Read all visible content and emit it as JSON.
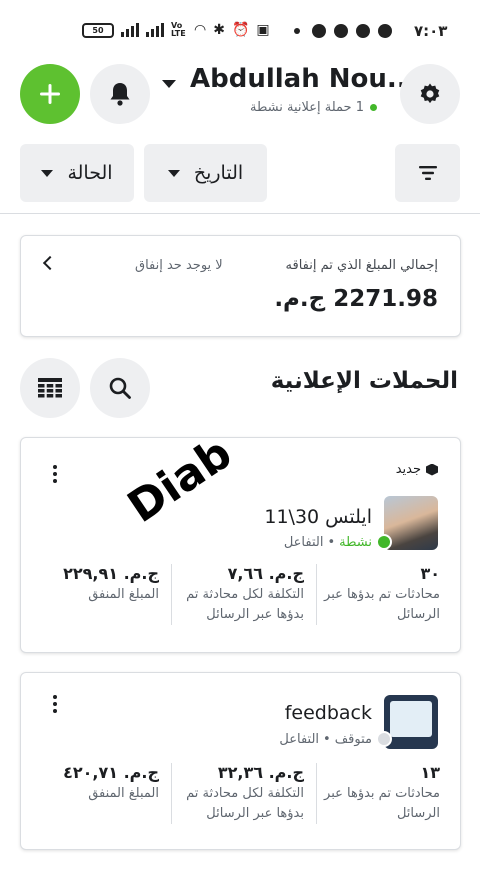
{
  "status_bar": {
    "time": "٧:٠٣",
    "battery": "50",
    "network_label": "Vo LTE"
  },
  "header": {
    "account_name": "Abdullah Nou...",
    "active_campaigns": "1 حملة إعلانية نشطة"
  },
  "filters": {
    "status_label": "الحالة",
    "date_label": "التاريخ"
  },
  "spend": {
    "label": "إجمالي المبلغ الذي تم إنفاقه",
    "limit_text": "لا يوجد حد إنفاق",
    "amount": "2271.98 ج.م."
  },
  "section_title": "الحملات الإعلانية",
  "campaigns": [
    {
      "badge": "جديد",
      "name": "ايلتس 30\\11",
      "status": "نشطة",
      "objective": "التفاعل",
      "status_color": "#42b72a",
      "conversations_value": "٣٠",
      "conversations_label": "محادثات تم بدؤها عبر الرسائل",
      "cost_value": "ج.م. ٧,٦٦",
      "cost_label": "التكلفة لكل محادثة تم بدؤها عبر الرسائل",
      "spent_value": "ج.م. ٢٢٩,٩١",
      "spent_label": "المبلغ المنفق"
    },
    {
      "name": "feedback",
      "status": "متوقف",
      "objective": "التفاعل",
      "status_color": "#dadde1",
      "conversations_value": "١٣",
      "conversations_label": "محادثات تم بدؤها عبر الرسائل",
      "cost_value": "ج.م. ٣٢,٣٦",
      "cost_label": "التكلفة لكل محادثة تم بدؤها عبر الرسائل",
      "spent_value": "ج.م. ٤٢٠,٧١",
      "spent_label": "المبلغ المنفق"
    }
  ],
  "watermark": "Diab",
  "colors": {
    "accent_green": "#5ec130",
    "active_green": "#42b72a",
    "button_gray": "#eeeff1"
  }
}
